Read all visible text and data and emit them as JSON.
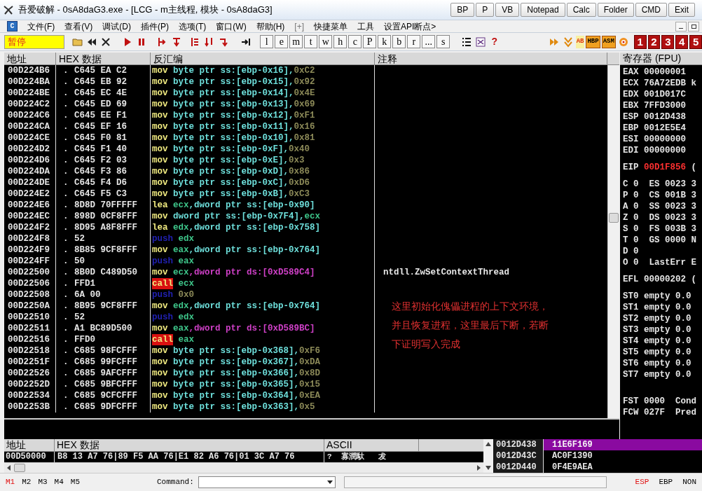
{
  "window": {
    "title": "吾爱破解 - 0sA8daG3.exe - [LCG - m主线程, 模块 - 0sA8daG3]",
    "buttons": [
      "BP",
      "P",
      "VB",
      "Notepad",
      "Calc",
      "Folder",
      "CMD",
      "Exit"
    ]
  },
  "logo": "C",
  "menu": [
    "文件(F)",
    "查看(V)",
    "调试(D)",
    "插件(P)",
    "选项(T)",
    "窗口(W)",
    "帮助(H)",
    "[+]",
    "快捷菜单",
    "工具",
    "设置API断点>"
  ],
  "toolbar": {
    "status": "暂停",
    "letters": [
      "l",
      "e",
      "m",
      "t",
      "w",
      "h",
      "c",
      "P",
      "k",
      "b",
      "r",
      "...",
      "s"
    ],
    "help": "?",
    "plugins": [
      "AB",
      "HBP",
      "ASM"
    ],
    "numbers": [
      "1",
      "2",
      "3",
      "4",
      "5"
    ]
  },
  "disasm": {
    "columns": [
      "地址",
      "HEX 数据",
      "反汇编",
      "注释"
    ],
    "rows": [
      {
        "address": "00D224B6",
        "mark": ".",
        "hex": "C645 EA C2",
        "asm": [
          {
            "text": "mov",
            "kind": "op"
          },
          {
            "text": "byte ptr ss:[ebp-0x16],",
            "kind": "mem"
          },
          {
            "text": "0xC2",
            "kind": "imm"
          }
        ]
      },
      {
        "address": "00D224BA",
        "mark": ".",
        "hex": "C645 EB 92",
        "asm": [
          {
            "text": "mov",
            "kind": "op"
          },
          {
            "text": "byte ptr ss:[ebp-0x15],",
            "kind": "mem"
          },
          {
            "text": "0x92",
            "kind": "imm"
          }
        ]
      },
      {
        "address": "00D224BE",
        "mark": ".",
        "hex": "C645 EC 4E",
        "asm": [
          {
            "text": "mov",
            "kind": "op"
          },
          {
            "text": "byte ptr ss:[ebp-0x14],",
            "kind": "mem"
          },
          {
            "text": "0x4E",
            "kind": "imm"
          }
        ]
      },
      {
        "address": "00D224C2",
        "mark": ".",
        "hex": "C645 ED 69",
        "asm": [
          {
            "text": "mov",
            "kind": "op"
          },
          {
            "text": "byte ptr ss:[ebp-0x13],",
            "kind": "mem"
          },
          {
            "text": "0x69",
            "kind": "imm"
          }
        ]
      },
      {
        "address": "00D224C6",
        "mark": ".",
        "hex": "C645 EE F1",
        "asm": [
          {
            "text": "mov",
            "kind": "op"
          },
          {
            "text": "byte ptr ss:[ebp-0x12],",
            "kind": "mem"
          },
          {
            "text": "0xF1",
            "kind": "imm"
          }
        ]
      },
      {
        "address": "00D224CA",
        "mark": ".",
        "hex": "C645 EF 16",
        "asm": [
          {
            "text": "mov",
            "kind": "op"
          },
          {
            "text": "byte ptr ss:[ebp-0x11],",
            "kind": "mem"
          },
          {
            "text": "0x16",
            "kind": "imm"
          }
        ]
      },
      {
        "address": "00D224CE",
        "mark": ".",
        "hex": "C645 F0 81",
        "asm": [
          {
            "text": "mov",
            "kind": "op"
          },
          {
            "text": "byte ptr ss:[ebp-0x10],",
            "kind": "mem"
          },
          {
            "text": "0x81",
            "kind": "imm"
          }
        ]
      },
      {
        "address": "00D224D2",
        "mark": ".",
        "hex": "C645 F1 40",
        "asm": [
          {
            "text": "mov",
            "kind": "op"
          },
          {
            "text": "byte ptr ss:[ebp-0xF],",
            "kind": "mem"
          },
          {
            "text": "0x40",
            "kind": "imm"
          }
        ]
      },
      {
        "address": "00D224D6",
        "mark": ".",
        "hex": "C645 F2 03",
        "asm": [
          {
            "text": "mov",
            "kind": "op"
          },
          {
            "text": "byte ptr ss:[ebp-0xE],",
            "kind": "mem"
          },
          {
            "text": "0x3",
            "kind": "imm"
          }
        ]
      },
      {
        "address": "00D224DA",
        "mark": ".",
        "hex": "C645 F3 86",
        "asm": [
          {
            "text": "mov",
            "kind": "op"
          },
          {
            "text": "byte ptr ss:[ebp-0xD],",
            "kind": "mem"
          },
          {
            "text": "0x86",
            "kind": "imm"
          }
        ]
      },
      {
        "address": "00D224DE",
        "mark": ".",
        "hex": "C645 F4 D6",
        "asm": [
          {
            "text": "mov",
            "kind": "op"
          },
          {
            "text": "byte ptr ss:[ebp-0xC],",
            "kind": "mem"
          },
          {
            "text": "0xD6",
            "kind": "imm"
          }
        ]
      },
      {
        "address": "00D224E2",
        "mark": ".",
        "hex": "C645 F5 C3",
        "asm": [
          {
            "text": "mov",
            "kind": "op"
          },
          {
            "text": "byte ptr ss:[ebp-0xB],",
            "kind": "mem"
          },
          {
            "text": "0xC3",
            "kind": "imm"
          }
        ]
      },
      {
        "address": "00D224E6",
        "mark": ".",
        "hex": "8D8D 70FFFFF",
        "asm": [
          {
            "text": "lea",
            "kind": "op"
          },
          {
            "text": "ecx",
            "kind": "reg"
          },
          {
            "text": ",dword ptr ss:[ebp-0x90]",
            "kind": "mem"
          }
        ]
      },
      {
        "address": "00D224EC",
        "mark": ".",
        "hex": "898D 0CF8FFF",
        "asm": [
          {
            "text": "mov",
            "kind": "op"
          },
          {
            "text": "dword ptr ss:[ebp-0x7F4],",
            "kind": "mem"
          },
          {
            "text": "ecx",
            "kind": "reg"
          }
        ]
      },
      {
        "address": "00D224F2",
        "mark": ".",
        "hex": "8D95 A8F8FFF",
        "asm": [
          {
            "text": "lea",
            "kind": "op"
          },
          {
            "text": "edx",
            "kind": "reg"
          },
          {
            "text": ",dword ptr ss:[ebp-0x758]",
            "kind": "mem"
          }
        ]
      },
      {
        "address": "00D224F8",
        "mark": ".",
        "hex": "52",
        "asm": [
          {
            "text": "push",
            "kind": "push"
          },
          {
            "text": "edx",
            "kind": "reg"
          }
        ]
      },
      {
        "address": "00D224F9",
        "mark": ".",
        "hex": "8B85 9CF8FFF",
        "asm": [
          {
            "text": "mov",
            "kind": "op"
          },
          {
            "text": "eax",
            "kind": "reg"
          },
          {
            "text": ",dword ptr ss:[ebp-0x764]",
            "kind": "mem"
          }
        ]
      },
      {
        "address": "00D224FF",
        "mark": ".",
        "hex": "50",
        "asm": [
          {
            "text": "push",
            "kind": "push"
          },
          {
            "text": "eax",
            "kind": "reg"
          }
        ]
      },
      {
        "address": "00D22500",
        "mark": ".",
        "hex": "8B0D C489D50",
        "asm": [
          {
            "text": "mov",
            "kind": "op"
          },
          {
            "text": "ecx",
            "kind": "reg"
          },
          {
            "text": ",dword ptr ds:[0xD589C4]",
            "kind": "ds"
          }
        ],
        "comment": "ntdll.ZwSetContextThread"
      },
      {
        "address": "00D22506",
        "mark": ".",
        "hex": "FFD1",
        "asm": [
          {
            "text": "call",
            "kind": "call"
          },
          {
            "text": "ecx",
            "kind": "reg"
          }
        ]
      },
      {
        "address": "00D22508",
        "mark": ".",
        "hex": "6A 00",
        "asm": [
          {
            "text": "push",
            "kind": "push"
          },
          {
            "text": "0x0",
            "kind": "imm"
          }
        ]
      },
      {
        "address": "00D2250A",
        "mark": ".",
        "hex": "8B95 9CF8FFF",
        "asm": [
          {
            "text": "mov",
            "kind": "op"
          },
          {
            "text": "edx",
            "kind": "reg"
          },
          {
            "text": ",dword ptr ss:[ebp-0x764]",
            "kind": "mem"
          }
        ]
      },
      {
        "address": "00D22510",
        "mark": ".",
        "hex": "52",
        "asm": [
          {
            "text": "push",
            "kind": "push"
          },
          {
            "text": "edx",
            "kind": "reg"
          }
        ]
      },
      {
        "address": "00D22511",
        "mark": ".",
        "hex": "A1 BC89D500",
        "asm": [
          {
            "text": "mov",
            "kind": "op"
          },
          {
            "text": "eax",
            "kind": "reg"
          },
          {
            "text": ",dword ptr ds:[0xD589BC]",
            "kind": "ds"
          }
        ]
      },
      {
        "address": "00D22516",
        "mark": ".",
        "hex": "FFD0",
        "asm": [
          {
            "text": "call",
            "kind": "call"
          },
          {
            "text": "eax",
            "kind": "reg"
          }
        ]
      },
      {
        "address": "00D22518",
        "mark": ".",
        "hex": "C685 98FCFFF",
        "asm": [
          {
            "text": "mov",
            "kind": "op"
          },
          {
            "text": "byte ptr ss:[ebp-0x368],",
            "kind": "mem"
          },
          {
            "text": "0xF6",
            "kind": "imm"
          }
        ]
      },
      {
        "address": "00D2251F",
        "mark": ".",
        "hex": "C685 99FCFFF",
        "asm": [
          {
            "text": "mov",
            "kind": "op"
          },
          {
            "text": "byte ptr ss:[ebp-0x367],",
            "kind": "mem"
          },
          {
            "text": "0xDA",
            "kind": "imm"
          }
        ]
      },
      {
        "address": "00D22526",
        "mark": ".",
        "hex": "C685 9AFCFFF",
        "asm": [
          {
            "text": "mov",
            "kind": "op"
          },
          {
            "text": "byte ptr ss:[ebp-0x366],",
            "kind": "mem"
          },
          {
            "text": "0x8D",
            "kind": "imm"
          }
        ]
      },
      {
        "address": "00D2252D",
        "mark": ".",
        "hex": "C685 9BFCFFF",
        "asm": [
          {
            "text": "mov",
            "kind": "op"
          },
          {
            "text": "byte ptr ss:[ebp-0x365],",
            "kind": "mem"
          },
          {
            "text": "0x15",
            "kind": "imm"
          }
        ]
      },
      {
        "address": "00D22534",
        "mark": ".",
        "hex": "C685 9CFCFFF",
        "asm": [
          {
            "text": "mov",
            "kind": "op"
          },
          {
            "text": "byte ptr ss:[ebp-0x364],",
            "kind": "mem"
          },
          {
            "text": "0xEA",
            "kind": "imm"
          }
        ]
      },
      {
        "address": "00D2253B",
        "mark": ".",
        "hex": "C685 9DFCFFF",
        "asm": [
          {
            "text": "mov",
            "kind": "op"
          },
          {
            "text": "byte ptr ss:[ebp-0x363],",
            "kind": "mem"
          },
          {
            "text": "0x5",
            "kind": "imm"
          }
        ]
      }
    ],
    "note": [
      "这里初始化傀儡进程的上下文环境，",
      "并且恢复进程，这里最后下断，若断",
      "下证明写入完成"
    ]
  },
  "registers": {
    "title": "寄存器 (FPU)",
    "general": [
      {
        "name": "EAX",
        "value": "00000001",
        "changed": false
      },
      {
        "name": "ECX",
        "value": "76A72EDB",
        "changed": false,
        "extra": "k"
      },
      {
        "name": "EDX",
        "value": "001D017C",
        "changed": false
      },
      {
        "name": "EBX",
        "value": "7FFD3000",
        "changed": false
      },
      {
        "name": "ESP",
        "value": "0012D438",
        "changed": false
      },
      {
        "name": "EBP",
        "value": "0012E5E4",
        "changed": false
      },
      {
        "name": "ESI",
        "value": "00000000",
        "changed": false
      },
      {
        "name": "EDI",
        "value": "00000000",
        "changed": false
      }
    ],
    "eip": {
      "name": "EIP",
      "value": "00D1F856",
      "changed": true,
      "extra": "("
    },
    "flags": [
      "C 0  ES 0023 3",
      "P 0  CS 001B 3",
      "A 0  SS 0023 3",
      "Z 0  DS 0023 3",
      "S 0  FS 003B 3",
      "T 0  GS 0000 N",
      "D 0",
      "O 0  LastErr E"
    ],
    "efl": "EFL 00000202 (",
    "fpu": [
      "ST0 empty 0.0",
      "ST1 empty 0.0",
      "ST2 empty 0.0",
      "ST3 empty 0.0",
      "ST4 empty 0.0",
      "ST5 empty 0.0",
      "ST6 empty 0.0",
      "ST7 empty 0.0"
    ],
    "status": [
      "FST 0000  Cond",
      "FCW 027F  Pred"
    ]
  },
  "dump": {
    "columns": [
      "地址",
      "HEX 数据",
      "ASCII"
    ],
    "rows": [
      {
        "address": "00D50000",
        "hex": "B8 13 A7 76|89 F5 AA 76|E1 82 A6 76|01 3C A7 76",
        "ascii": "?  寡潤馱   犮"
      }
    ]
  },
  "stack": [
    {
      "address": "0012D438",
      "value": "11E6F169",
      "selected": true
    },
    {
      "address": "0012D43C",
      "value": "AC0F1390",
      "selected": false
    },
    {
      "address": "0012D440",
      "value": "0F4E9AEA",
      "selected": false
    }
  ],
  "status_bar": {
    "memory_tabs": [
      {
        "label": "M1",
        "selected": true
      },
      {
        "label": "M2",
        "selected": false
      },
      {
        "label": "M3",
        "selected": false
      },
      {
        "label": "M4",
        "selected": false
      },
      {
        "label": "M5",
        "selected": false
      }
    ],
    "command_label": "Command:",
    "base_tabs": [
      {
        "label": "ESP",
        "selected": true
      },
      {
        "label": "EBP",
        "selected": false
      },
      {
        "label": "NON",
        "selected": false
      }
    ]
  }
}
